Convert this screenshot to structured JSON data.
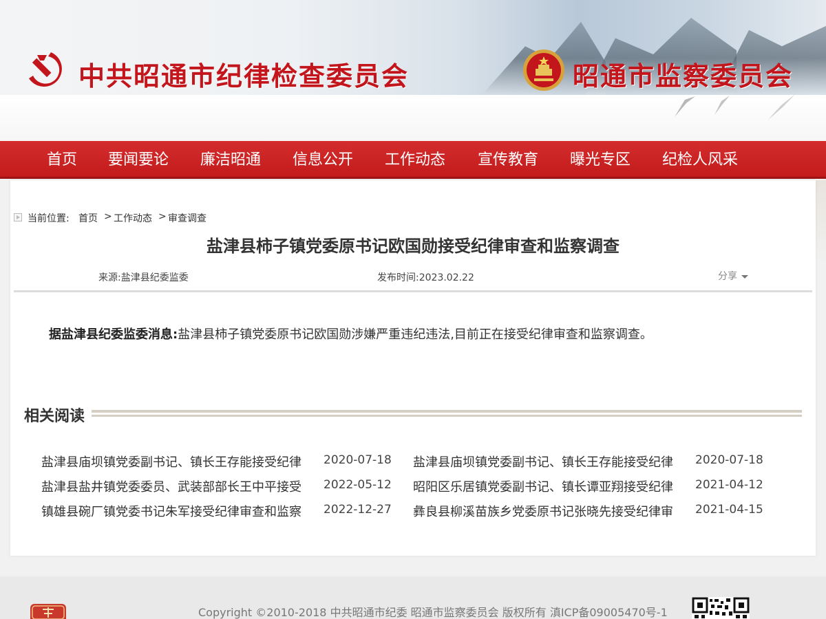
{
  "header": {
    "title_left": "中共昭通市纪律检查委员会",
    "title_right": "昭通市监察委员会"
  },
  "nav": {
    "items": [
      "首页",
      "要闻要论",
      "廉洁昭通",
      "信息公开",
      "工作动态",
      "宣传教育",
      "曝光专区",
      "纪检人风采"
    ]
  },
  "breadcrumb": {
    "label": "当前位置:",
    "items": [
      "首页",
      "工作动态",
      "审查调查"
    ],
    "separator": ">"
  },
  "article": {
    "title": "盐津县柿子镇党委原书记欧国勋接受纪律审查和监察调查",
    "source": "来源:盐津县纪委监委",
    "published": "发布时间:2023.02.22",
    "share_label": "分享",
    "lead": "据盐津县纪委监委消息:",
    "body": "盐津县柿子镇党委原书记欧国勋涉嫌严重违纪违法,目前正在接受纪律审查和监察调查。"
  },
  "related": {
    "title": "相关阅读",
    "items": [
      {
        "title": "盐津县庙坝镇党委副书记、镇长王存能接受纪律",
        "date": "2020-07-18"
      },
      {
        "title": "盐津县庙坝镇党委副书记、镇长王存能接受纪律",
        "date": "2020-07-18"
      },
      {
        "title": "盐津县盐井镇党委委员、武装部部长王中平接受",
        "date": "2022-05-12"
      },
      {
        "title": "昭阳区乐居镇党委副书记、镇长谭亚翔接受纪律",
        "date": "2021-04-12"
      },
      {
        "title": "镇雄县碗厂镇党委书记朱军接受纪律审查和监察",
        "date": "2022-12-27"
      },
      {
        "title": "彝良县柳溪苗族乡党委原书记张晓先接受纪律审",
        "date": "2021-04-15"
      }
    ]
  },
  "footer": {
    "copyright": "Copyright ©2010-2018 中共昭通市纪委 昭通市监察委员会 版权所有 滇ICP备09005470号-1"
  },
  "colors": {
    "brand_red": "#c3161c",
    "nav_red": "#cf2424"
  }
}
